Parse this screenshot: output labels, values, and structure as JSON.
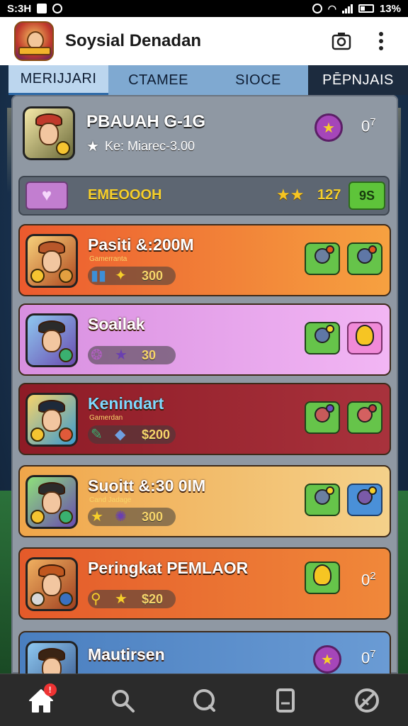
{
  "status_bar": {
    "time": "S:3H",
    "battery": "13%"
  },
  "app": {
    "title": "Soysial Denadan"
  },
  "tabs": [
    {
      "label": "MERIJJARI"
    },
    {
      "label": "CTAMEE"
    },
    {
      "label": "SIOCE"
    },
    {
      "label": "PĒPNJAIS"
    }
  ],
  "profile": {
    "name": "PBAUAH G-1G",
    "subtitle": "Ke: Miarec-3.00",
    "badge_count": "0",
    "badge_sup": "7"
  },
  "highlight_row": {
    "label": "EMEOOOH",
    "value": "127",
    "button_label": "9S"
  },
  "cards": [
    {
      "title": "Pasiti &:200M",
      "subtitle": "Gamerranta",
      "stat": "300",
      "color_top": "#ec5a2e",
      "color_bottom": "#f6a140"
    },
    {
      "title": "Soailak",
      "subtitle": "",
      "stat": "30",
      "color_top": "#d88fe0",
      "color_bottom": "#f2b6f4"
    },
    {
      "title": "Kenindart",
      "subtitle": "Gamerdan",
      "stat": "$200",
      "color_top": "#8e1b26",
      "color_bottom": "#a8323c"
    },
    {
      "title": "Suoitt &:30 0IM",
      "subtitle": "Cand Jadage",
      "stat": "300",
      "color_top": "#f0a64a",
      "color_bottom": "#f4d18a"
    },
    {
      "title": "Peringkat PEMLAOR",
      "subtitle": "",
      "stat": "$20",
      "count": "0",
      "count_sup": "2",
      "color_top": "#e45a2a",
      "color_bottom": "#f0883a"
    },
    {
      "title": "Mautirsen",
      "subtitle": "",
      "count": "0",
      "count_sup": "7",
      "color_top": "#4a7fc0",
      "color_bottom": "#6a9bd4"
    }
  ],
  "icons": {
    "home": "home-icon",
    "search": "search-icon",
    "chat": "chat-icon",
    "document": "document-icon",
    "settings": "settings-icon"
  },
  "home_badge": "!"
}
